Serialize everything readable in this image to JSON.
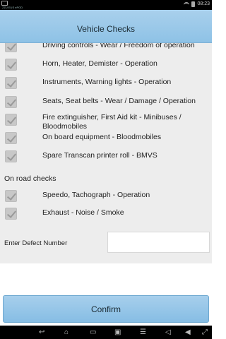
{
  "status_bar": {
    "app_text": "ZZU EUS ePOD",
    "time": "08:23"
  },
  "header": {
    "title": "Vehicle Checks"
  },
  "checks": [
    {
      "label": "Driving controls - Wear / Freedom of operation",
      "checked": true
    },
    {
      "label": "Horn, Heater, Demister - Operation",
      "checked": true
    },
    {
      "label": "Instruments, Warning lights - Operation",
      "checked": true
    },
    {
      "label": "Seats, Seat belts - Wear / Damage / Operation",
      "checked": true
    },
    {
      "label": "Fire extinguisher, First Aid kit - Minibuses / Bloodmobiles",
      "checked": true
    },
    {
      "label": "On board equipment - Bloodmobiles",
      "checked": true
    },
    {
      "label": "Spare Transcan printer roll - BMVS",
      "checked": true
    }
  ],
  "on_road": {
    "heading": "On road checks",
    "items": [
      {
        "label": "Speedo, Tachograph - Operation",
        "checked": true
      },
      {
        "label": "Exhaust - Noise / Smoke",
        "checked": true
      }
    ]
  },
  "defect": {
    "label": "Enter Defect Number",
    "value": ""
  },
  "confirm_label": "Confirm",
  "nav_icons": [
    "back-icon",
    "home-icon",
    "recent-apps-icon",
    "screenshot-icon",
    "menu-icon",
    "volume-down-icon",
    "volume-up-icon",
    "expand-icon"
  ]
}
